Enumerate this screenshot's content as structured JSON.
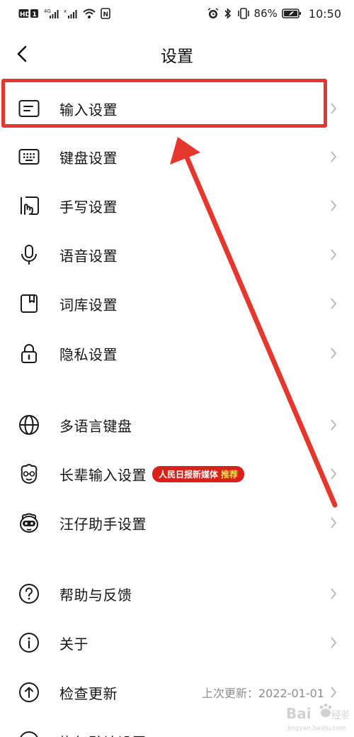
{
  "status_bar": {
    "left_icons": [
      "hd-icon",
      "signal-4g-icon",
      "signal-icon",
      "wifi-icon",
      "nfc-icon"
    ],
    "right_icons": [
      "alarm-icon",
      "bluetooth-icon",
      "vibrate-icon"
    ],
    "battery_percent": "86%",
    "time": "10:50"
  },
  "header": {
    "title": "设置",
    "back_icon": "chevron-left-icon"
  },
  "settings": [
    {
      "label": "输入设置",
      "icon": "input-box-icon"
    },
    {
      "label": "键盘设置",
      "icon": "keyboard-icon"
    },
    {
      "label": "手写设置",
      "icon": "handwriting-icon"
    },
    {
      "label": "语音设置",
      "icon": "microphone-icon"
    },
    {
      "label": "词库设置",
      "icon": "dictionary-icon"
    },
    {
      "label": "隐私设置",
      "icon": "lock-icon"
    },
    {
      "label": "多语言键盘",
      "icon": "globe-icon"
    },
    {
      "label": "长辈输入设置",
      "icon": "elder-face-icon",
      "badge": "人民日报新媒体",
      "badge_tag": "推荐"
    },
    {
      "label": "汪仔助手设置",
      "icon": "mascot-face-icon"
    },
    {
      "label": "帮助与反馈",
      "icon": "help-circle-icon"
    },
    {
      "label": "关于",
      "icon": "info-circle-icon"
    },
    {
      "label": "检查更新",
      "icon": "update-circle-icon",
      "meta": "上次更新：2022-01-01"
    },
    {
      "label": "恢复默认设置",
      "icon": "reset-circle-icon"
    }
  ],
  "annotation": {
    "highlight_color": "#e5372d",
    "arrow_color": "#e5372d"
  },
  "watermark": {
    "text": "Bai 经验",
    "sub": "jingyan.baidu.com"
  }
}
